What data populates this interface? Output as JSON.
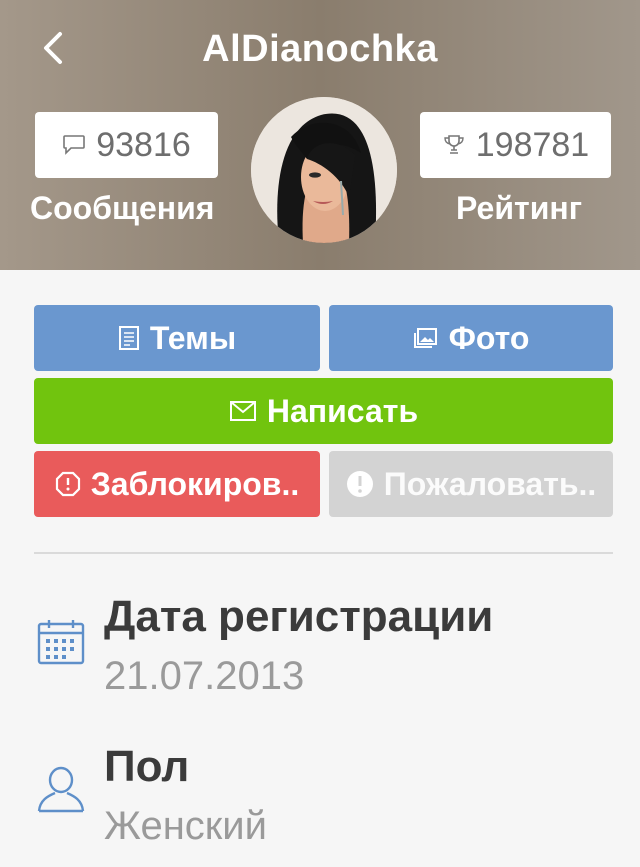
{
  "header": {
    "title": "AlDianochka",
    "messages_count": "93816",
    "messages_label": "Сообщения",
    "rating_count": "198781",
    "rating_label": "Рейтинг"
  },
  "buttons": {
    "topics": "Темы",
    "photo": "Фото",
    "write": "Написать",
    "block": "Заблокиров..",
    "report": "Пожаловать.."
  },
  "info": {
    "registration_label": "Дата регистрации",
    "registration_value": "21.07.2013",
    "gender_label": "Пол",
    "gender_value": "Женский"
  },
  "icons": {
    "back": "chevron-left-icon",
    "messages": "speech-bubble-icon",
    "rating": "trophy-icon",
    "topics": "document-icon",
    "photo": "image-icon",
    "write": "envelope-icon",
    "block": "octagon-block-icon",
    "report": "exclamation-icon",
    "registration": "calendar-icon",
    "gender": "person-icon"
  },
  "colors": {
    "blue": "#6a97cf",
    "green": "#71c40e",
    "red": "#e95b5b",
    "gray": "#d3d3d3",
    "icon_blue": "#5e8fc9"
  }
}
